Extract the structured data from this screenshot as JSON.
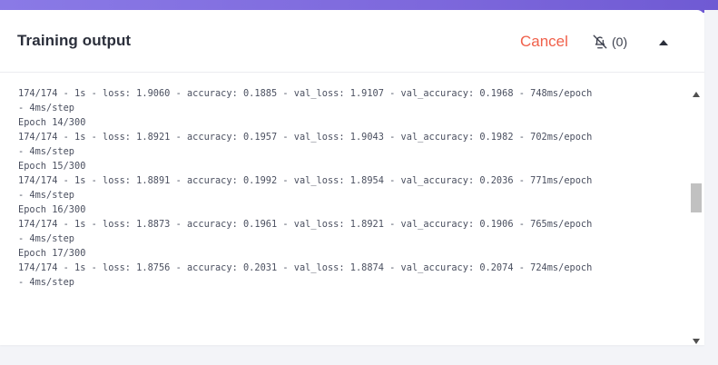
{
  "header": {
    "title": "Training output",
    "cancel_label": "Cancel",
    "notification_count": "(0)"
  },
  "log": {
    "lines": [
      "174/174 - 1s - loss: 1.9060 - accuracy: 0.1885 - val_loss: 1.9107 - val_accuracy: 0.1968 - 748ms/epoch",
      "- 4ms/step",
      "Epoch 14/300",
      "174/174 - 1s - loss: 1.8921 - accuracy: 0.1957 - val_loss: 1.9043 - val_accuracy: 0.1982 - 702ms/epoch",
      "- 4ms/step",
      "Epoch 15/300",
      "174/174 - 1s - loss: 1.8891 - accuracy: 0.1992 - val_loss: 1.8954 - val_accuracy: 0.2036 - 771ms/epoch",
      "- 4ms/step",
      "Epoch 16/300",
      "174/174 - 1s - loss: 1.8873 - accuracy: 0.1961 - val_loss: 1.8921 - val_accuracy: 0.1906 - 765ms/epoch",
      "- 4ms/step",
      "Epoch 17/300",
      "174/174 - 1s - loss: 1.8756 - accuracy: 0.2031 - val_loss: 1.8874 - val_accuracy: 0.2074 - 724ms/epoch",
      "- 4ms/step"
    ]
  },
  "icons": {
    "notification": "bell-off-icon",
    "collapse": "caret-up-icon",
    "scroll_up": "scroll-up-arrow-icon",
    "scroll_down": "scroll-down-arrow-icon"
  },
  "colors": {
    "accent_gradient_start": "#8a7ae6",
    "accent_gradient_end": "#6f5ad3",
    "cancel": "#f0604a",
    "title": "#2b2f3b",
    "log_text": "#4b5060"
  }
}
